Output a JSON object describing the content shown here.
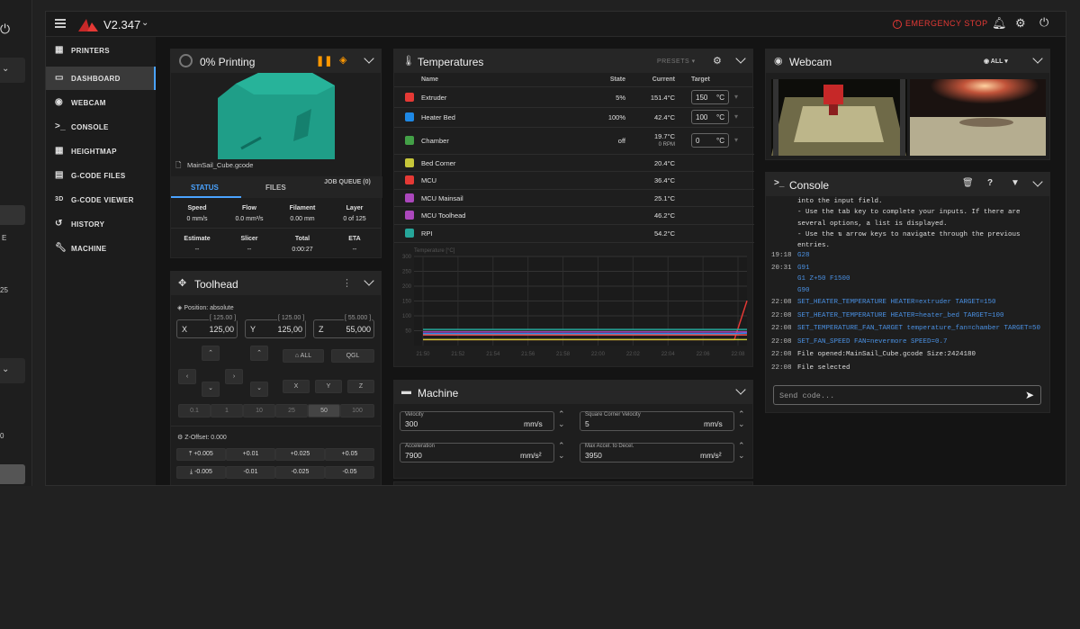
{
  "app": {
    "version": "V2.347",
    "emergency_stop": "EMERGENCY STOP"
  },
  "nav": [
    {
      "label": "PRINTERS",
      "icon": "printers-icon"
    },
    {
      "label": "DASHBOARD",
      "icon": "dashboard-icon"
    },
    {
      "label": "WEBCAM",
      "icon": "webcam-icon"
    },
    {
      "label": "CONSOLE",
      "icon": "console-icon"
    },
    {
      "label": "HEIGHTMAP",
      "icon": "heightmap-icon"
    },
    {
      "label": "G-CODE FILES",
      "icon": "gcode-files-icon"
    },
    {
      "label": "G-CODE VIEWER",
      "icon": "gcode-viewer-icon",
      "prefix": "3D"
    },
    {
      "label": "HISTORY",
      "icon": "history-icon"
    },
    {
      "label": "MACHINE",
      "icon": "machine-icon"
    }
  ],
  "status": {
    "title": "0% Printing",
    "filename": "MainSail_Cube.gcode",
    "tabs": [
      "STATUS",
      "FILES",
      "JOB QUEUE (0)"
    ],
    "row1": [
      {
        "h": "Speed",
        "v": "0 mm/s"
      },
      {
        "h": "Flow",
        "v": "0.0 mm³/s"
      },
      {
        "h": "Filament",
        "v": "0.00 mm"
      },
      {
        "h": "Layer",
        "v": "0 of 125"
      }
    ],
    "row2": [
      {
        "h": "Estimate",
        "v": "--"
      },
      {
        "h": "Slicer",
        "v": "--"
      },
      {
        "h": "Total",
        "v": "0:00:27"
      },
      {
        "h": "ETA",
        "v": "--"
      }
    ]
  },
  "toolhead": {
    "title": "Toolhead",
    "position": "Position: absolute",
    "axes": [
      {
        "axis": "X",
        "max": "[ 125.00 ]",
        "value": "125,00"
      },
      {
        "axis": "Y",
        "max": "[ 125.00 ]",
        "value": "125,00"
      },
      {
        "axis": "Z",
        "max": "[ 55.000 ]",
        "value": "55,000"
      }
    ],
    "home_all": "ALL",
    "qgl": "QGL",
    "home_x": "X",
    "home_y": "Y",
    "home_z": "Z",
    "steps": [
      "0.1",
      "1",
      "10",
      "25",
      "50",
      "100"
    ],
    "zoffset": "Z-Offset: 0.000",
    "zup": [
      "+0.005",
      "+0.01",
      "+0.025",
      "+0.05"
    ],
    "zdown": [
      "-0.005",
      "-0.01",
      "-0.025",
      "-0.05"
    ]
  },
  "temps": {
    "title": "Temperatures",
    "presets": "PRESETS",
    "headers": {
      "name": "Name",
      "state": "State",
      "current": "Current",
      "target": "Target"
    },
    "rows": [
      {
        "name": "Extruder",
        "state": "5%",
        "current": "151.4°C",
        "target": "150",
        "unit": "°C",
        "color": "#e53935"
      },
      {
        "name": "Heater Bed",
        "state": "100%",
        "current": "42.4°C",
        "target": "100",
        "unit": "°C",
        "color": "#1e88e5"
      },
      {
        "name": "Chamber",
        "state": "off",
        "current": "19.7°C",
        "sub": "0 RPM",
        "target": "0",
        "unit": "°C",
        "color": "#43a047"
      },
      {
        "name": "Bed Corner",
        "current": "20.4°C",
        "color": "#c6c63a"
      },
      {
        "name": "MCU",
        "current": "36.4°C",
        "color": "#e53935"
      },
      {
        "name": "MCU Mainsail",
        "current": "25.1°C",
        "color": "#ab47bc"
      },
      {
        "name": "MCU Toolhead",
        "current": "46.2°C",
        "color": "#ab47bc"
      },
      {
        "name": "RPI",
        "current": "54.2°C",
        "color": "#26a69a"
      }
    ]
  },
  "chart_data": {
    "type": "line",
    "ylabel": "Temperature [°C]",
    "ylim": [
      0,
      300
    ],
    "yticks": [
      "300",
      "250",
      "200",
      "150",
      "100",
      "50"
    ],
    "categories": [
      "21:50",
      "21:52",
      "21:54",
      "21:56",
      "21:58",
      "22:00",
      "22:02",
      "22:04",
      "22:06",
      "22:08"
    ],
    "series": [
      {
        "name": "Extruder",
        "values": [
          20,
          20,
          20,
          20,
          20,
          20,
          20,
          20,
          20,
          151
        ],
        "color": "#e53935"
      },
      {
        "name": "Heater Bed",
        "values": [
          40,
          40,
          40,
          40,
          40,
          40,
          40,
          40,
          40,
          42
        ],
        "color": "#1e88e5"
      },
      {
        "name": "RPI",
        "values": [
          54,
          54,
          54,
          54,
          54,
          54,
          54,
          54,
          54,
          54
        ],
        "color": "#26a69a"
      },
      {
        "name": "MCU Toolhead",
        "values": [
          46,
          46,
          46,
          46,
          46,
          46,
          46,
          46,
          46,
          46
        ],
        "color": "#ab47bc"
      },
      {
        "name": "MCU",
        "values": [
          36,
          36,
          36,
          36,
          36,
          36,
          36,
          36,
          36,
          36
        ],
        "color": "#ef5350"
      },
      {
        "name": "Bed Corner",
        "values": [
          20,
          20,
          20,
          20,
          20,
          20,
          20,
          20,
          20,
          20
        ],
        "color": "#c6c63a"
      }
    ]
  },
  "machine": {
    "title": "Machine",
    "velocity": {
      "label": "Velocity",
      "value": "300",
      "unit": "mm/s"
    },
    "scv": {
      "label": "Square Corner Velocity",
      "value": "5",
      "unit": "mm/s"
    },
    "accel": {
      "label": "Acceleration",
      "value": "7900",
      "unit": "mm/s²"
    },
    "decel": {
      "label": "Max Accel. to Decel.",
      "value": "3950",
      "unit": "mm/s²"
    }
  },
  "webcam": {
    "title": "Webcam",
    "filter": "ALL"
  },
  "console": {
    "title": "Console",
    "intro": [
      "into the input field.",
      "- Use the tab key to complete your inputs. If there are",
      "several options, a list is displayed.",
      "- Use the ⇅ arrow keys to navigate through the previous",
      "entries."
    ],
    "lines": [
      {
        "time": "19:18",
        "text": "G28",
        "cmd": true
      },
      {
        "time": "20:31",
        "text": "G91",
        "cmd": true
      },
      {
        "time": "",
        "text": "G1 Z+50 F1500",
        "cmd": true
      },
      {
        "time": "",
        "text": "G90",
        "cmd": true
      },
      {
        "time": "22:08",
        "text": "SET_HEATER_TEMPERATURE HEATER=extruder TARGET=150",
        "cmd": true
      },
      {
        "time": "22:08",
        "text": "SET_HEATER_TEMPERATURE HEATER=heater_bed TARGET=100",
        "cmd": true
      },
      {
        "time": "22:08",
        "text": "SET_TEMPERATURE_FAN_TARGET temperature_fan=chamber TARGET=50",
        "cmd": true
      },
      {
        "time": "22:08",
        "text": "SET_FAN_SPEED FAN=nevermore SPEED=0.7",
        "cmd": true
      },
      {
        "time": "22:08",
        "text": "File opened:MainSail_Cube.gcode Size:2424180",
        "cmd": false
      },
      {
        "time": "22:08",
        "text": "File selected",
        "cmd": false
      }
    ],
    "placeholder": "Send code..."
  },
  "ghost": {
    "e": "E",
    "v1": "25",
    "v2": "0"
  }
}
